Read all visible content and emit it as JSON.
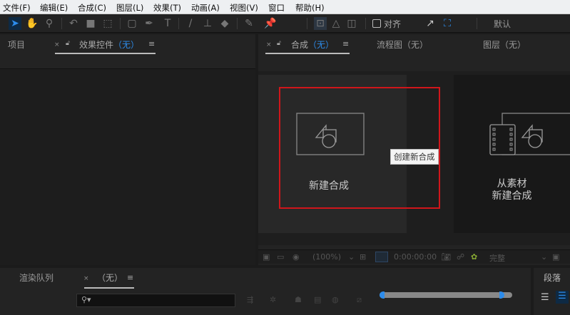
{
  "menu": [
    "文件(F)",
    "编辑(E)",
    "合成(C)",
    "图层(L)",
    "效果(T)",
    "动画(A)",
    "视图(V)",
    "窗口",
    "帮助(H)"
  ],
  "toolbar": {
    "snap_label": "对齐",
    "workspace_label": "默认"
  },
  "left_panel": {
    "tabs": [
      {
        "label": "项目"
      },
      {
        "label": "效果控件",
        "suffix": "（无）"
      }
    ]
  },
  "viewer": {
    "tabs": [
      {
        "label": "合成",
        "suffix": "（无）"
      },
      {
        "label": "流程图（无）"
      },
      {
        "label": "图层（无）"
      }
    ],
    "new_comp_label": "新建合成",
    "tooltip": "创建新合成",
    "from_footage_line1": "从素材",
    "from_footage_line2": "新建合成",
    "zoom": "(100%)",
    "timecode": "0:00:00:00",
    "resolution": "完整"
  },
  "bottom": {
    "render_queue_tab": "渲染队列",
    "timeline_tab": "（无）",
    "paragraph_tab": "段落"
  },
  "colors": {
    "accent": "#2d8ceb",
    "highlight": "#d0161b"
  }
}
